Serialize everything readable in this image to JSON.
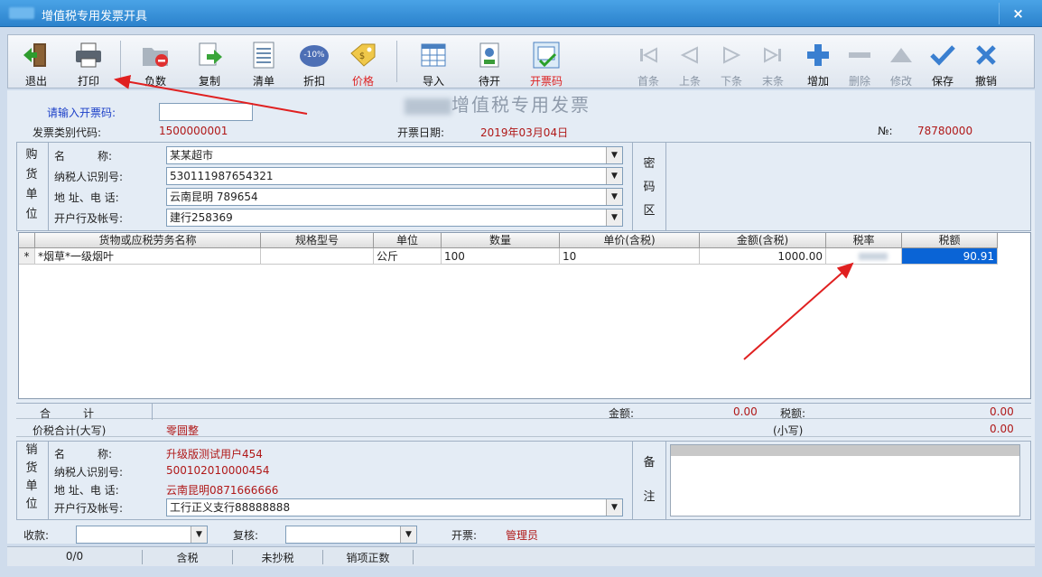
{
  "window": {
    "title": "增值税专用发票开具",
    "close": "×"
  },
  "toolbar": {
    "left": [
      {
        "id": "exit",
        "label": "退出",
        "icon": "exit-door-icon"
      },
      {
        "id": "print",
        "label": "打印",
        "icon": "printer-icon"
      },
      {
        "id": "negative",
        "label": "负数",
        "icon": "negative-folder-icon"
      },
      {
        "id": "copy",
        "label": "复制",
        "icon": "copy-doc-icon"
      },
      {
        "id": "list",
        "label": "清单",
        "icon": "list-sheet-icon"
      },
      {
        "id": "discount",
        "label": "折扣",
        "icon": "discount-icon",
        "badge": "-10%"
      },
      {
        "id": "price",
        "label": "价格",
        "icon": "price-tag-icon",
        "red": true
      },
      {
        "id": "import",
        "label": "导入",
        "icon": "import-table-icon"
      },
      {
        "id": "pending",
        "label": "待开",
        "icon": "pending-icon"
      },
      {
        "id": "invoice_code",
        "label": "开票码",
        "icon": "invoice-code-icon",
        "red": true
      }
    ],
    "right": [
      {
        "id": "first",
        "label": "首条",
        "icon": "first-record-icon",
        "disabled": true
      },
      {
        "id": "prev",
        "label": "上条",
        "icon": "prev-record-icon",
        "disabled": true
      },
      {
        "id": "next",
        "label": "下条",
        "icon": "next-record-icon",
        "disabled": true
      },
      {
        "id": "last",
        "label": "末条",
        "icon": "last-record-icon",
        "disabled": true
      },
      {
        "id": "add",
        "label": "增加",
        "icon": "plus-icon"
      },
      {
        "id": "delete",
        "label": "删除",
        "icon": "minus-icon",
        "disabled": true
      },
      {
        "id": "edit",
        "label": "修改",
        "icon": "triangle-up-icon",
        "disabled": true
      },
      {
        "id": "save",
        "label": "保存",
        "icon": "checkmark-icon"
      },
      {
        "id": "cancel",
        "label": "撤销",
        "icon": "cancel-x-icon"
      }
    ]
  },
  "form": {
    "heading": "增值税专用发票",
    "code_prompt": "请输入开票码:",
    "code_value": "",
    "type_code_label": "发票类别代码:",
    "type_code": "1500000001",
    "date_label": "开票日期:",
    "date": "2019年03月04日",
    "no_label": "№:",
    "no": "78780000"
  },
  "buyer": {
    "side_label": [
      "购",
      "货",
      "单",
      "位"
    ],
    "name_label": "名　　　称:",
    "name": "某某超市",
    "tax_id_label": "纳税人识别号:",
    "tax_id": "530111987654321",
    "addr_label": "地 址、电 话:",
    "addr": "云南昆明 789654",
    "bank_label": "开户行及帐号:",
    "bank": "建行258369",
    "cipher_label": [
      "密",
      "码",
      "区"
    ]
  },
  "table": {
    "headers": [
      "货物或应税劳务名称",
      "规格型号",
      "单位",
      "数量",
      "单价(含税)",
      "金额(含税)",
      "税率",
      "税额"
    ],
    "rows": [
      {
        "marker": "*",
        "name": "*烟草*一级烟叶",
        "spec": "",
        "unit": "公斤",
        "qty": "100",
        "price": "10",
        "amount": "1000.00",
        "rate": "",
        "tax": "90.91"
      }
    ]
  },
  "totals": {
    "total_label": "合　　　计",
    "amount_label": "金额:",
    "amount": "0.00",
    "tax_label": "税额:",
    "tax": "0.00",
    "upper_label": "价税合计(大写)",
    "upper": "零圆整",
    "lower_label": "(小写)",
    "lower": "0.00"
  },
  "seller": {
    "side_label": [
      "销",
      "货",
      "单",
      "位"
    ],
    "name_label": "名　　　称:",
    "name": "升级版测试用户454",
    "tax_id_label": "纳税人识别号:",
    "tax_id": "500102010000454",
    "addr_label": "地 址、电 话:",
    "addr": "云南昆明0871666666",
    "bank_label": "开户行及帐号:",
    "bank": "工行正义支行88888888",
    "remark_label": [
      "备",
      "注"
    ]
  },
  "footer": {
    "payee_label": "收款:",
    "payee": "",
    "reviewer_label": "复核:",
    "reviewer": "",
    "issuer_label": "开票:",
    "issuer": "管理员"
  },
  "status": {
    "count": "0/0",
    "tax_mode": "含税",
    "copy_state": "未抄税",
    "item_state": "销项正数"
  },
  "colors": {
    "title_bar": "#2b82cc",
    "accent_red": "#b01818",
    "selected_cell": "#0a64d6",
    "arrow": "#e02020"
  }
}
